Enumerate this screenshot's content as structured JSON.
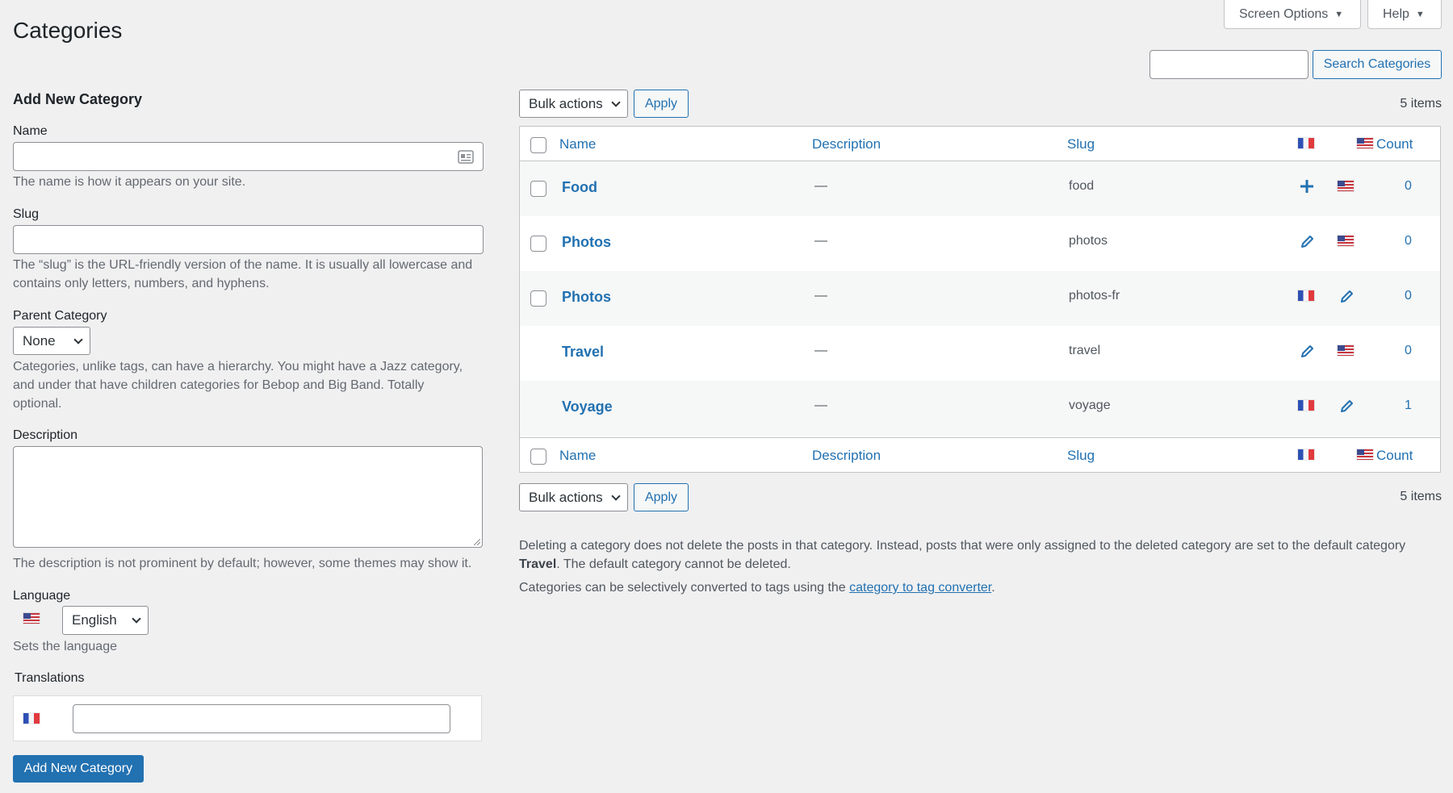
{
  "header": {
    "title": "Categories",
    "screen_options": "Screen Options",
    "help": "Help"
  },
  "search": {
    "placeholder": "",
    "button": "Search Categories"
  },
  "form": {
    "heading": "Add New Category",
    "name_label": "Name",
    "name_value": "",
    "name_help": "The name is how it appears on your site.",
    "slug_label": "Slug",
    "slug_value": "",
    "slug_help_1": "The “slug” is the URL-friendly version of the name. It is usually all lowercase and",
    "slug_help_2": "contains only letters, numbers, and hyphens.",
    "parent_label": "Parent Category",
    "parent_value": "None",
    "parent_help_1": "Categories, unlike tags, can have a hierarchy. You might have a Jazz category,",
    "parent_help_2": "and under that have children categories for Bebop and Big Band. Totally",
    "parent_help_3": "optional.",
    "description_label": "Description",
    "description_value": "",
    "description_help": "The description is not prominent by default; however, some themes may show it.",
    "language_label": "Language",
    "language_value": "English",
    "language_help": "Sets the language",
    "translations_label": "Translations",
    "translation_value": "",
    "submit": "Add New Category"
  },
  "table": {
    "bulk_actions": "Bulk actions",
    "apply": "Apply",
    "items_count": "5 items",
    "columns": {
      "name": "Name",
      "description": "Description",
      "slug": "Slug",
      "count": "Count"
    },
    "rows": [
      {
        "name": "Food",
        "description": "—",
        "slug": "food",
        "count": "0",
        "fr": "add",
        "en": "flag-us",
        "checkbox": true
      },
      {
        "name": "Photos",
        "description": "—",
        "slug": "photos",
        "count": "0",
        "fr": "edit",
        "en": "flag-us",
        "checkbox": true
      },
      {
        "name": "Photos",
        "description": "—",
        "slug": "photos-fr",
        "count": "0",
        "fr": "flag-fr",
        "en": "edit",
        "checkbox": true
      },
      {
        "name": "Travel",
        "description": "—",
        "slug": "travel",
        "count": "0",
        "fr": "edit",
        "en": "flag-us",
        "checkbox": false
      },
      {
        "name": "Voyage",
        "description": "—",
        "slug": "voyage",
        "count": "1",
        "fr": "flag-fr",
        "en": "edit",
        "checkbox": false
      }
    ]
  },
  "notes": {
    "line1": "Deleting a category does not delete the posts in that category. Instead, posts that were only assigned to the deleted category are set to the default category",
    "line2_bold": "Travel",
    "line2_rest": ". The default category cannot be deleted.",
    "line3_prefix": "Categories can be selectively converted to tags using the ",
    "line3_link": "category to tag converter",
    "line3_suffix": "."
  },
  "colors": {
    "accent": "#2271b1",
    "background": "#f0f0f1"
  }
}
